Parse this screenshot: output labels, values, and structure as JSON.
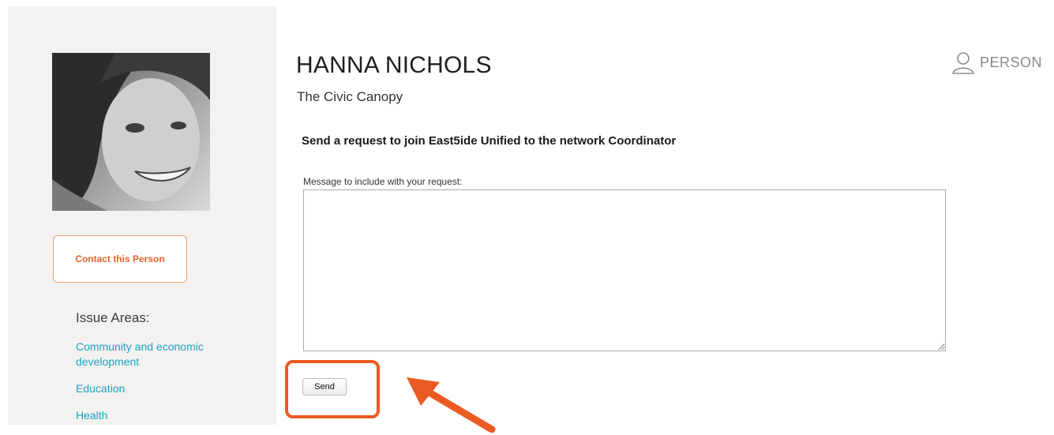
{
  "profile": {
    "name": "HANNA NICHOLS",
    "organization": "The Civic Canopy",
    "type_label": "PERSON",
    "type_icon": "person-outline-icon",
    "contact_button_label": "Contact this Person"
  },
  "issue_areas": {
    "title": "Issue Areas:",
    "items": [
      "Community and economic development",
      "Education",
      "Health"
    ]
  },
  "request_form": {
    "heading": "Send a request to join East5ide Unified to the network Coordinator",
    "message_label": "Message to include with your request:",
    "message_value": "",
    "send_label": "Send"
  },
  "annotations": {
    "highlight_color": "#ea5b24",
    "arrow_icon": "arrow-up-left-icon"
  },
  "colors": {
    "accent_orange": "#e8632b",
    "link_teal": "#1ba3c2",
    "sidebar_bg": "#f3f2f0"
  }
}
